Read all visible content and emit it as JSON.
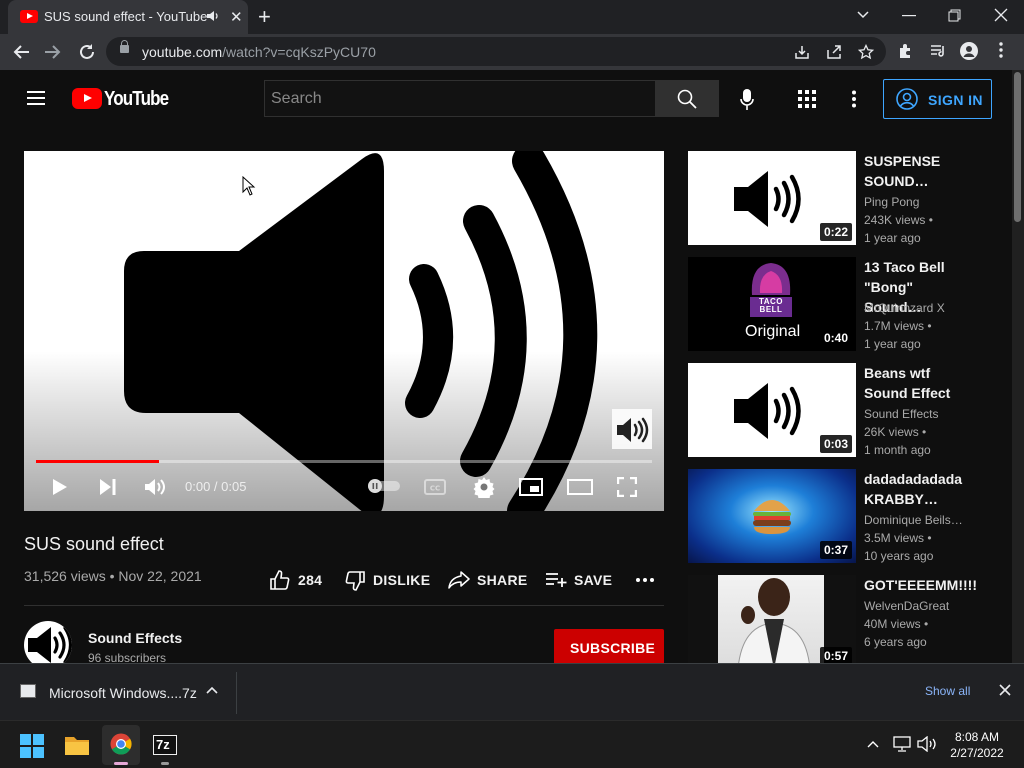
{
  "browser": {
    "tab_title": "SUS sound effect - YouTube",
    "url_host": "youtube.com",
    "url_path": "/watch?v=cqKszPyCU70"
  },
  "youtube": {
    "logo_text": "YouTube",
    "search_placeholder": "Search",
    "signin_label": "SIGN IN"
  },
  "player": {
    "time_display": "0:00 / 0:05",
    "progress_fraction": 0.2
  },
  "video": {
    "title": "SUS sound effect",
    "meta": "31,526 views • Nov 22, 2021",
    "likes": "284",
    "dislike_label": "DISLIKE",
    "share_label": "SHARE",
    "save_label": "SAVE"
  },
  "channel": {
    "name": "Sound Effects",
    "subscribers": "96 subscribers",
    "subscribe_label": "SUBSCRIBE"
  },
  "recommendations": [
    {
      "title": "SUSPENSE SOUND…",
      "channel": "Ping Pong",
      "views": "243K views •",
      "age": "1 year ago",
      "duration": "0:22",
      "thumb": "speaker-white"
    },
    {
      "title": "13 Taco Bell \"Bong\" Sound…",
      "channel": "MrQuinnzard X",
      "views": "1.7M views •",
      "age": "1 year ago",
      "duration": "0:40",
      "thumb": "taco-bell",
      "thumb_caption": "Original",
      "thumb_logo_text": "TACO BELL"
    },
    {
      "title": "Beans wtf Sound Effect",
      "channel": "Sound Effects",
      "views": "26K views •",
      "age": "1 month ago",
      "duration": "0:03",
      "thumb": "speaker-white"
    },
    {
      "title": "dadadadadada KRABBY…",
      "channel": "Dominique Beils…",
      "views": "3.5M views •",
      "age": "10 years ago",
      "duration": "0:37",
      "thumb": "burger-blue"
    },
    {
      "title": "GOT'EEEEMM!!!!",
      "channel": "WelvenDaGreat",
      "views": "40M views •",
      "age": "6 years ago",
      "duration": "0:57",
      "thumb": "person-photo"
    }
  ],
  "download": {
    "filename": "Microsoft Windows....7z",
    "show_all_label": "Show all"
  },
  "taskbar": {
    "app_7z_label": "7z",
    "time": "8:08 AM",
    "date": "2/27/2022"
  },
  "colors": {
    "yt_red": "#ff0000",
    "link_blue": "#3ea6ff",
    "subscribe_red": "#cc0000"
  }
}
